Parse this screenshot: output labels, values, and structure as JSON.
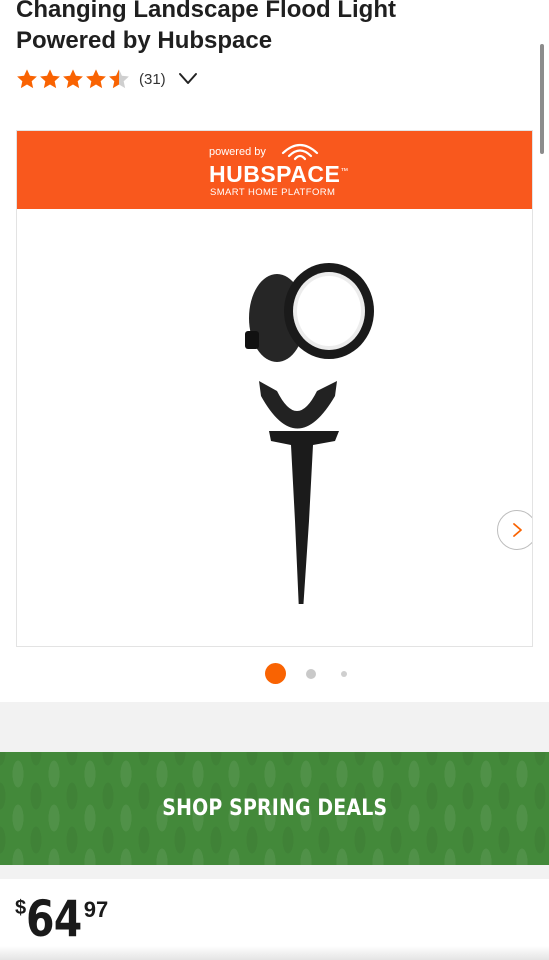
{
  "product": {
    "title_line1": "Changing Landscape Flood Light",
    "title_line2": "Powered by Hubspace",
    "rating": 4.5,
    "review_count": "(31)"
  },
  "gallery": {
    "brand": {
      "powered_by": "powered by",
      "name": "HUBSPACE",
      "trademark": "™",
      "tagline": "SMART HOME PLATFORM"
    },
    "image_icon": "landscape-flood-light",
    "current_slide": 1,
    "slide_count": 3
  },
  "promo": {
    "label": "SHOP SPRING DEALS"
  },
  "price": {
    "currency": "$",
    "dollars": "64",
    "cents": "97"
  },
  "colors": {
    "accent_orange": "#f96302",
    "banner_orange": "#f9581d",
    "promo_green": "#43893a"
  }
}
